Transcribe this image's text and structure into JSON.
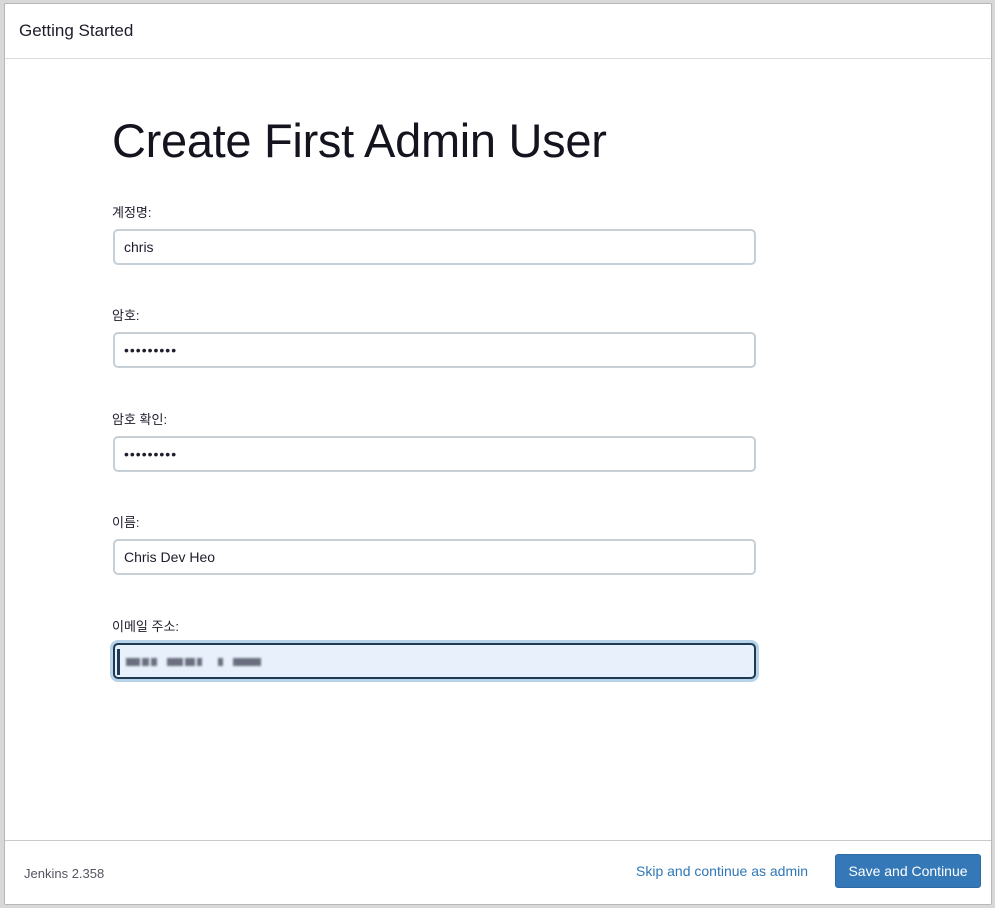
{
  "header": {
    "title": "Getting Started"
  },
  "form": {
    "title": "Create First Admin User",
    "fields": [
      {
        "label": "계정명:",
        "value": "chris",
        "type": "text"
      },
      {
        "label": "암호:",
        "value": "•••••••••",
        "type": "password"
      },
      {
        "label": "암호 확인:",
        "value": "•••••••••",
        "type": "password"
      },
      {
        "label": "이름:",
        "value": "Chris Dev Heo",
        "type": "text"
      },
      {
        "label": "이메일 주소:",
        "value": "",
        "type": "email",
        "focused": true,
        "obscured": true
      }
    ]
  },
  "footer": {
    "version": "Jenkins 2.358",
    "skip_label": "Skip and continue as admin",
    "save_label": "Save and Continue"
  },
  "colors": {
    "primary_button": "#3478b8",
    "link": "#2f77b6",
    "focus_ring": "#b7d3e8",
    "focused_input_bg": "#e8f0fb"
  }
}
